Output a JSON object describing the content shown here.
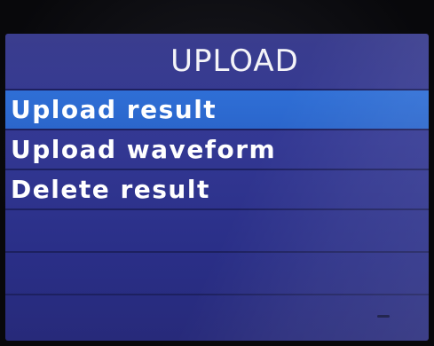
{
  "screen": {
    "title": "UPLOAD"
  },
  "menu": {
    "items": [
      {
        "label": "Upload result",
        "selected": true
      },
      {
        "label": "Upload waveform",
        "selected": false
      },
      {
        "label": "Delete result",
        "selected": false
      },
      {
        "label": "",
        "selected": false
      },
      {
        "label": "",
        "selected": false
      },
      {
        "label": "",
        "selected": false
      }
    ]
  },
  "colors": {
    "background": "#333893",
    "selection": "#2f6fd6",
    "text": "#ffffff",
    "divider": "#1d2060"
  }
}
